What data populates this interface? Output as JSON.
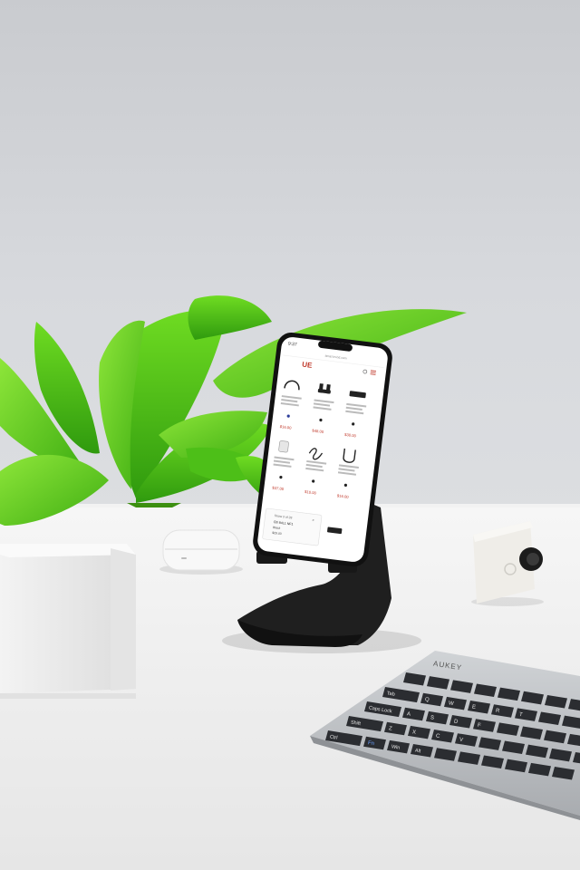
{
  "phone_screen": {
    "status_time": "9:37",
    "address_text": "amazon.bd.com",
    "logo_text": "UE",
    "products": [
      {
        "price": "$16.00"
      },
      {
        "price": "$48.00"
      },
      {
        "price": "$30.00"
      },
      {
        "price": "$37.00"
      },
      {
        "price": "$10.00"
      },
      {
        "price": "$16.00"
      }
    ],
    "cart_popup": {
      "line1": "Show 3 of 28",
      "line2": "CB 84L1 NF1",
      "line3": "Black",
      "line4": "$29.00"
    }
  },
  "keyboard": {
    "brand": "AUKEY",
    "keys": [
      "Tab",
      "Caps Lock",
      "Shift",
      "Ctrl",
      "Fn",
      "Win",
      "Alt",
      "Q",
      "W",
      "E",
      "R",
      "T",
      "A",
      "S",
      "D",
      "F",
      "Z",
      "X",
      "C",
      "V"
    ]
  },
  "colors": {
    "wall": "#d2d4d8",
    "desk": "#eeeeee",
    "leaf": "#5fd21c",
    "stand": "#1f1f1f",
    "keyboard_body": "#b9bcc0",
    "key": "#2b2d31",
    "price_red": "#c0392b"
  }
}
